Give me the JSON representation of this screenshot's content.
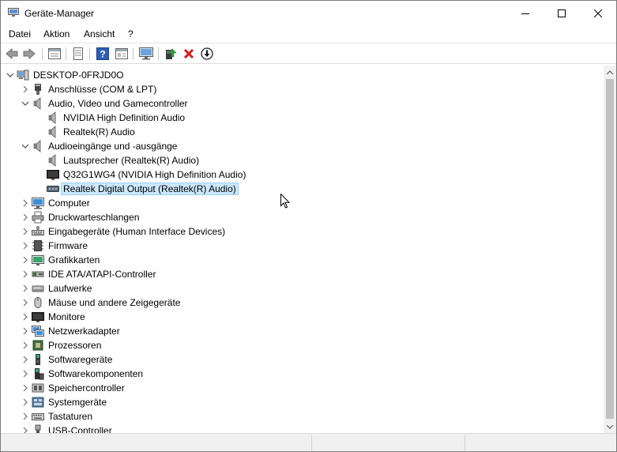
{
  "window": {
    "title": "Geräte-Manager"
  },
  "menu": [
    {
      "label": "Datei"
    },
    {
      "label": "Aktion"
    },
    {
      "label": "Ansicht"
    },
    {
      "label": "?"
    }
  ],
  "toolbar": [
    {
      "name": "back-icon"
    },
    {
      "name": "forward-icon"
    },
    {
      "name": "properties-icon"
    },
    {
      "name": "show-hide-icon"
    },
    {
      "name": "help-icon"
    },
    {
      "name": "view-icon"
    },
    {
      "name": "monitor-icon"
    },
    {
      "name": "update-driver-icon"
    },
    {
      "name": "uninstall-icon"
    },
    {
      "name": "disable-icon"
    }
  ],
  "tree": {
    "root": {
      "label": "DESKTOP-0FRJD0O",
      "icon": "computer-icon"
    },
    "items": [
      {
        "label": "Anschlüsse (COM & LPT)",
        "level": 1,
        "expander": "collapsed",
        "icon": "port-icon"
      },
      {
        "label": "Audio, Video und Gamecontroller",
        "level": 1,
        "expander": "expanded",
        "icon": "speaker-icon"
      },
      {
        "label": "NVIDIA High Definition Audio",
        "level": 2,
        "expander": "none",
        "icon": "speaker-icon"
      },
      {
        "label": "Realtek(R) Audio",
        "level": 2,
        "expander": "none",
        "icon": "speaker-icon"
      },
      {
        "label": "Audioeingänge und -ausgänge",
        "level": 1,
        "expander": "expanded",
        "icon": "speaker-icon"
      },
      {
        "label": "Lautsprecher (Realtek(R) Audio)",
        "level": 2,
        "expander": "none",
        "icon": "speaker-icon"
      },
      {
        "label": "Q32G1WG4 (NVIDIA High Definition Audio)",
        "level": 2,
        "expander": "none",
        "icon": "monitor-device-icon"
      },
      {
        "label": "Realtek Digital Output (Realtek(R) Audio)",
        "level": 2,
        "expander": "none",
        "icon": "digital-output-icon",
        "selected": true
      },
      {
        "label": "Computer",
        "level": 1,
        "expander": "collapsed",
        "icon": "computer-monitor-icon"
      },
      {
        "label": "Druckwarteschlangen",
        "level": 1,
        "expander": "collapsed",
        "icon": "printer-icon"
      },
      {
        "label": "Eingabegeräte (Human Interface Devices)",
        "level": 1,
        "expander": "collapsed",
        "icon": "hid-icon"
      },
      {
        "label": "Firmware",
        "level": 1,
        "expander": "collapsed",
        "icon": "firmware-icon"
      },
      {
        "label": "Grafikkarten",
        "level": 1,
        "expander": "collapsed",
        "icon": "display-adapter-icon"
      },
      {
        "label": "IDE ATA/ATAPI-Controller",
        "level": 1,
        "expander": "collapsed",
        "icon": "ide-controller-icon"
      },
      {
        "label": "Laufwerke",
        "level": 1,
        "expander": "collapsed",
        "icon": "disk-drive-icon"
      },
      {
        "label": "Mäuse und andere Zeigegeräte",
        "level": 1,
        "expander": "collapsed",
        "icon": "mouse-icon"
      },
      {
        "label": "Monitore",
        "level": 1,
        "expander": "collapsed",
        "icon": "monitor-device-icon"
      },
      {
        "label": "Netzwerkadapter",
        "level": 1,
        "expander": "collapsed",
        "icon": "network-adapter-icon"
      },
      {
        "label": "Prozessoren",
        "level": 1,
        "expander": "collapsed",
        "icon": "processor-icon"
      },
      {
        "label": "Softwaregeräte",
        "level": 1,
        "expander": "collapsed",
        "icon": "software-device-icon"
      },
      {
        "label": "Softwarekomponenten",
        "level": 1,
        "expander": "collapsed",
        "icon": "software-component-icon"
      },
      {
        "label": "Speichercontroller",
        "level": 1,
        "expander": "collapsed",
        "icon": "storage-controller-icon"
      },
      {
        "label": "Systemgeräte",
        "level": 1,
        "expander": "collapsed",
        "icon": "system-device-icon"
      },
      {
        "label": "Tastaturen",
        "level": 1,
        "expander": "collapsed",
        "icon": "keyboard-icon"
      },
      {
        "label": "USB-Controller",
        "level": 1,
        "expander": "collapsed",
        "icon": "usb-icon"
      }
    ]
  },
  "colors": {
    "selection": "#cce8ff",
    "selection_border": "#99d1ff",
    "uninstall_red": "#d9191c"
  }
}
